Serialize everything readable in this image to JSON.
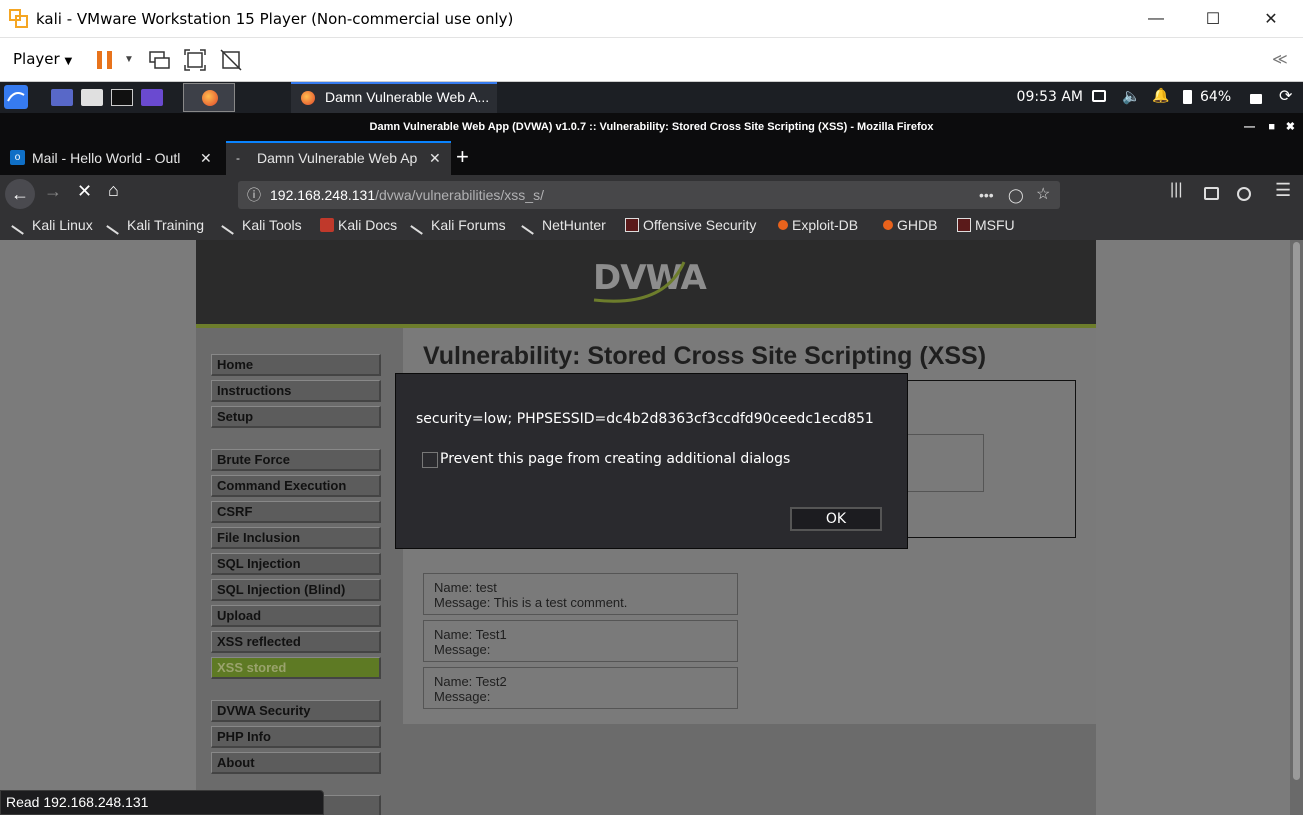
{
  "vmware": {
    "title": "kali - VMware Workstation 15 Player (Non-commercial use only)",
    "player_label": "Player"
  },
  "kali_panel": {
    "firefox_task": "Damn Vulnerable Web A...",
    "clock": "09:53 AM",
    "battery": "64%"
  },
  "firefox": {
    "window_title": "Damn Vulnerable Web App (DVWA) v1.0.7 :: Vulnerability: Stored Cross Site Scripting (XSS) - Mozilla Firefox",
    "tabs": [
      {
        "label": "Mail - Hello World - Outl"
      },
      {
        "label": "Damn Vulnerable Web Ap"
      }
    ],
    "url_host": "192.168.248.131",
    "url_path": "/dvwa/vulnerabilities/xss_s/",
    "bookmarks": [
      {
        "label": "Kali Linux"
      },
      {
        "label": "Kali Training"
      },
      {
        "label": "Kali Tools"
      },
      {
        "label": "Kali Docs"
      },
      {
        "label": "Kali Forums"
      },
      {
        "label": "NetHunter"
      },
      {
        "label": "Offensive Security"
      },
      {
        "label": "Exploit-DB"
      },
      {
        "label": "GHDB"
      },
      {
        "label": "MSFU"
      }
    ],
    "status_text": "Read 192.168.248.131"
  },
  "dvwa": {
    "logo": "DVWA",
    "page_title": "Vulnerability: Stored Cross Site Scripting (XSS)",
    "menu": [
      {
        "label": "Home"
      },
      {
        "label": "Instructions"
      },
      {
        "label": "Setup"
      },
      {
        "label": "Brute Force"
      },
      {
        "label": "Command Execution"
      },
      {
        "label": "CSRF"
      },
      {
        "label": "File Inclusion"
      },
      {
        "label": "SQL Injection"
      },
      {
        "label": "SQL Injection (Blind)"
      },
      {
        "label": "Upload"
      },
      {
        "label": "XSS reflected"
      },
      {
        "label": "XSS stored"
      },
      {
        "label": "DVWA Security"
      },
      {
        "label": "PHP Info"
      },
      {
        "label": "About"
      }
    ],
    "comments": [
      {
        "name": "Name: test",
        "message": "Message: This is a test comment."
      },
      {
        "name": "Name: Test1",
        "message": "Message:"
      },
      {
        "name": "Name: Test2",
        "message": "Message:"
      }
    ]
  },
  "dialog": {
    "message": "security=low; PHPSESSID=dc4b2d8363cf3ccdfd90ceedc1ecd851",
    "checkbox_label": "Prevent this page from creating additional dialogs",
    "ok_label": "OK"
  }
}
